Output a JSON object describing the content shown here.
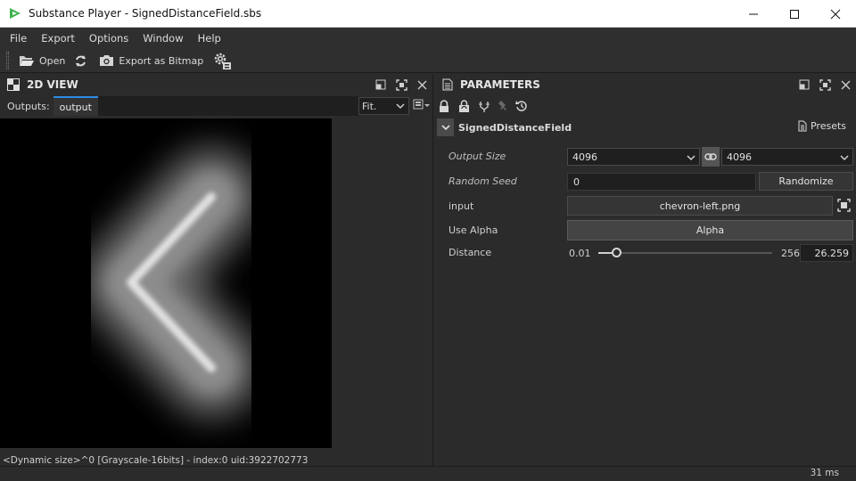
{
  "window": {
    "title": "Substance Player - SignedDistanceField.sbs"
  },
  "menu": [
    "File",
    "Export",
    "Options",
    "Window",
    "Help"
  ],
  "toolbar": {
    "open_label": "Open",
    "export_label": "Export as Bitmap"
  },
  "view2d": {
    "title": "2D VIEW",
    "outputs_label": "Outputs:",
    "output_tab": "output",
    "zoom_mode": "Fit.",
    "status": "<Dynamic size>^0 [Grayscale-16bits] - index:0 uid:3922702773"
  },
  "parameters": {
    "title": "PARAMETERS",
    "group_name": "SignedDistanceField",
    "presets_label": "Presets",
    "output_size": {
      "label": "Output Size",
      "width_value": "4096",
      "height_value": "4096"
    },
    "random_seed": {
      "label": "Random Seed",
      "value": "0",
      "randomize_label": "Randomize"
    },
    "input": {
      "label": "input",
      "file": "chevron-left.png"
    },
    "use_alpha": {
      "label": "Use Alpha",
      "button": "Alpha"
    },
    "distance": {
      "label": "Distance",
      "min": "0.01",
      "max": "256",
      "value": "26.259"
    }
  },
  "footer": {
    "render_time": "31 ms"
  },
  "colors": {
    "accent": "#2d8ce0",
    "background": "#2b2b2b",
    "field_bg": "#1f1f1f",
    "viewport_bg": "#000000"
  }
}
